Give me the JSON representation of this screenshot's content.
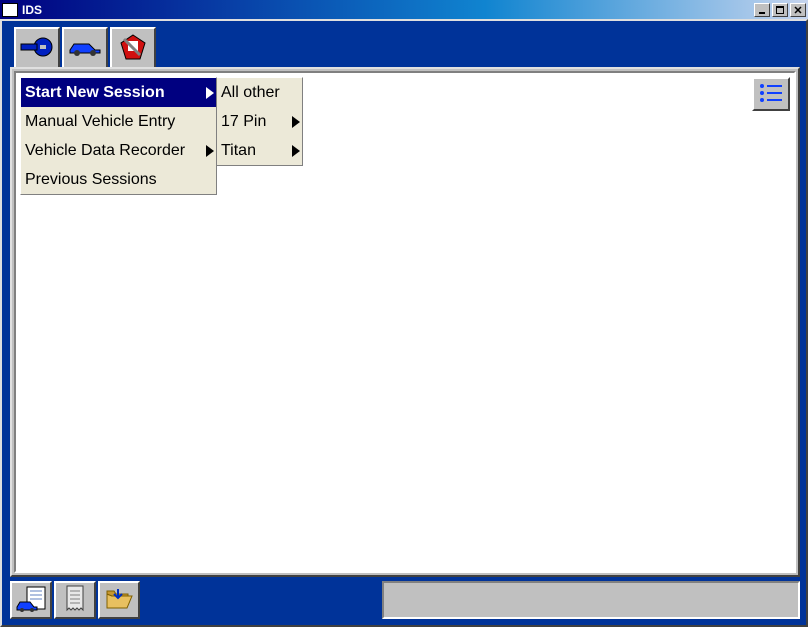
{
  "window": {
    "title": "IDS"
  },
  "top_tabs": [
    {
      "name": "home-tab",
      "icon": "home-arrow-icon"
    },
    {
      "name": "vehicle-tab",
      "icon": "car-icon",
      "active": true
    },
    {
      "name": "tools-tab",
      "icon": "toolbox-icon"
    }
  ],
  "menu": {
    "items": [
      {
        "label": "Start New Session",
        "has_submenu": true,
        "selected": true
      },
      {
        "label": "Manual Vehicle Entry",
        "has_submenu": false
      },
      {
        "label": "Vehicle Data Recorder",
        "has_submenu": true
      },
      {
        "label": "Previous Sessions",
        "has_submenu": false
      }
    ],
    "submenu": [
      {
        "label": "All other",
        "has_submenu": false
      },
      {
        "label": "17 Pin",
        "has_submenu": true
      },
      {
        "label": "Titan",
        "has_submenu": true
      }
    ]
  },
  "right_button": {
    "name": "list-view-button",
    "icon": "list-icon"
  },
  "bottom_buttons": [
    {
      "name": "vehicle-info-button",
      "icon": "car-sheet-icon"
    },
    {
      "name": "log-button",
      "icon": "receipt-icon"
    },
    {
      "name": "open-folder-button",
      "icon": "folder-open-icon"
    }
  ],
  "status": {
    "text": ""
  }
}
